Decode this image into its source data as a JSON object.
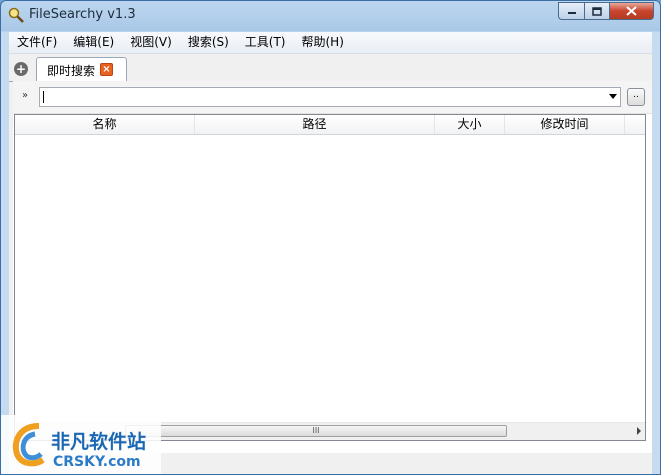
{
  "window": {
    "title": "FileSearchy v1.3"
  },
  "menu": [
    "文件(F)",
    "编辑(E)",
    "视图(V)",
    "搜索(S)",
    "工具(T)",
    "帮助(H)"
  ],
  "tabs": [
    {
      "label": "即时搜索",
      "active": true
    }
  ],
  "search": {
    "value": "",
    "expand_label": "»",
    "browse_label": ".."
  },
  "columns": [
    "名称",
    "路径",
    "大小",
    "修改时间"
  ],
  "scrollbar": {
    "grip": "III"
  },
  "watermark": {
    "line1": "非凡软件站",
    "line2": "CRSKY.com"
  },
  "colors": {
    "accent": "#1b67b3",
    "tab_close": "#e8621f",
    "close_button": "#c9442d"
  }
}
